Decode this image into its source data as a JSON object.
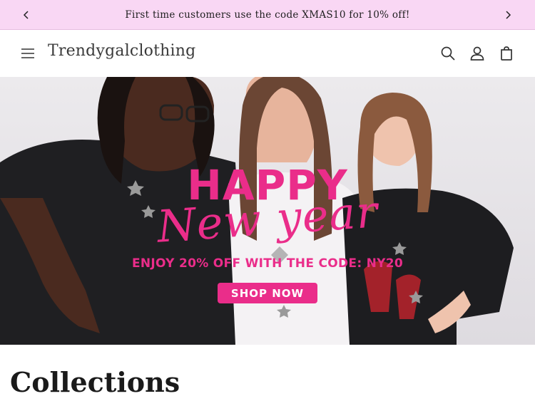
{
  "announcement": {
    "text": "First time customers use the code XMAS10 for 10% off!",
    "prev_icon": "chevron-left-icon",
    "next_icon": "chevron-right-icon"
  },
  "header": {
    "logo": "Trendygalclothing",
    "icons": [
      "menu-icon",
      "search-icon",
      "account-icon",
      "cart-icon"
    ]
  },
  "hero": {
    "headline": "HAPPY",
    "script_text": "New year",
    "promo": "ENJOY 20% OFF WITH THE CODE: NY20",
    "cta": "SHOP NOW",
    "accent_color": "#ea2d8a"
  },
  "collections": {
    "title": "Collections"
  },
  "colors": {
    "announcement_bg": "#f9d7f4",
    "brand_pink": "#ea2d8a",
    "text_dark": "#1a1a1a"
  }
}
